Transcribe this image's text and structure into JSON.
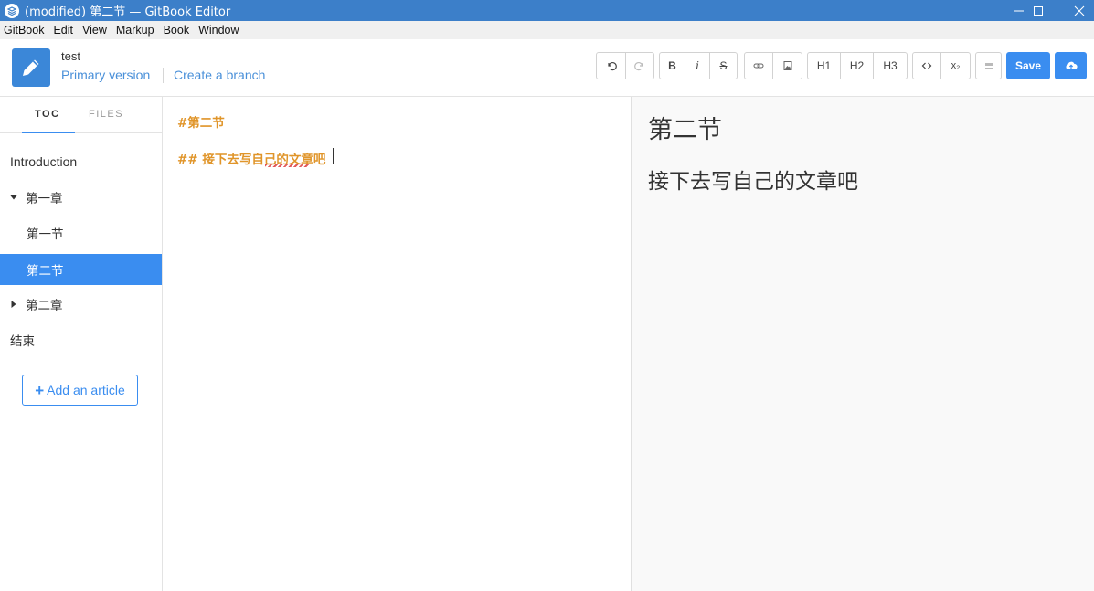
{
  "window": {
    "title": "(modified) 第二节 — GitBook Editor"
  },
  "menubar": {
    "items": [
      "GitBook",
      "Edit",
      "View",
      "Markup",
      "Book",
      "Window"
    ]
  },
  "header": {
    "book_title": "test",
    "version_label": "Primary version",
    "branch_label": "Create a branch"
  },
  "toolbar": {
    "bold": "B",
    "italic": "i",
    "strike": "S",
    "h1": "H1",
    "h2": "H2",
    "h3": "H3",
    "subscript": "x₂",
    "save": "Save"
  },
  "sidebar": {
    "tabs": [
      "TOC",
      "FILES"
    ],
    "toc": [
      {
        "label": "Introduction"
      },
      {
        "label": "第一章"
      },
      {
        "label": "第一节"
      },
      {
        "label": "第二节"
      },
      {
        "label": "第二章"
      },
      {
        "label": "结束"
      }
    ],
    "add_label": "Add an article"
  },
  "editor": {
    "line1": "#第二节",
    "line2": "## 接下去写自己的文章吧"
  },
  "preview": {
    "h1": "第二节",
    "h2": "接下去写自己的文章吧"
  },
  "colors": {
    "accent": "#3a8df0",
    "titlebar": "#3c7fc9",
    "markdown": "#e0952a"
  }
}
